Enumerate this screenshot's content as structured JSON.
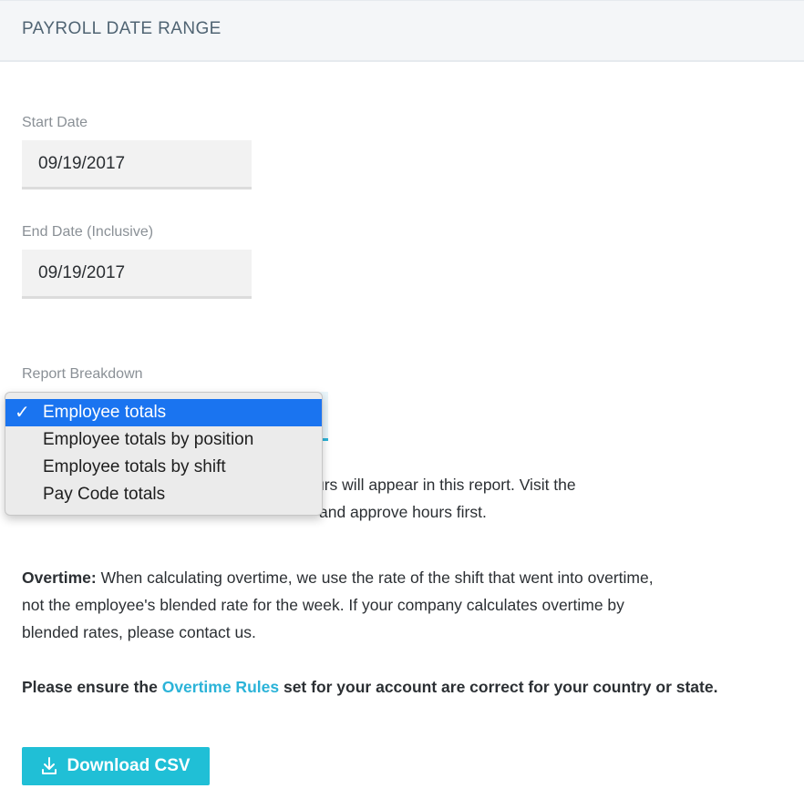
{
  "header": {
    "title": "PAYROLL DATE RANGE"
  },
  "start_date": {
    "label": "Start Date",
    "value": "09/19/2017"
  },
  "end_date": {
    "label": "End Date (Inclusive)",
    "value": "09/19/2017"
  },
  "report_breakdown": {
    "label": "Report Breakdown",
    "selected": "Employee totals",
    "options": [
      "Employee totals",
      "Employee totals by position",
      "Employee totals by shift",
      "Pay Code totals"
    ],
    "check_glyph": "✓"
  },
  "approval_note": {
    "line1_visible": "urs will appear in this report. Visit the",
    "line2_visible": "and approve hours first."
  },
  "overtime_note": {
    "label": "Overtime:",
    "line1": " When calculating overtime, we use the rate of the shift that went into overtime,",
    "line2": "not the employee's blended rate for the week. If your company calculates overtime by",
    "line3": "blended rates, please contact us."
  },
  "ensure_note": {
    "before": "Please ensure the ",
    "link": "Overtime Rules",
    "after": " set for your account are correct for your country or state."
  },
  "download_button": {
    "label": "Download CSV",
    "icon": "download-icon"
  },
  "colors": {
    "accent": "#2bb3d8",
    "button": "#20bfd6",
    "selected_option": "#1a74f0"
  }
}
